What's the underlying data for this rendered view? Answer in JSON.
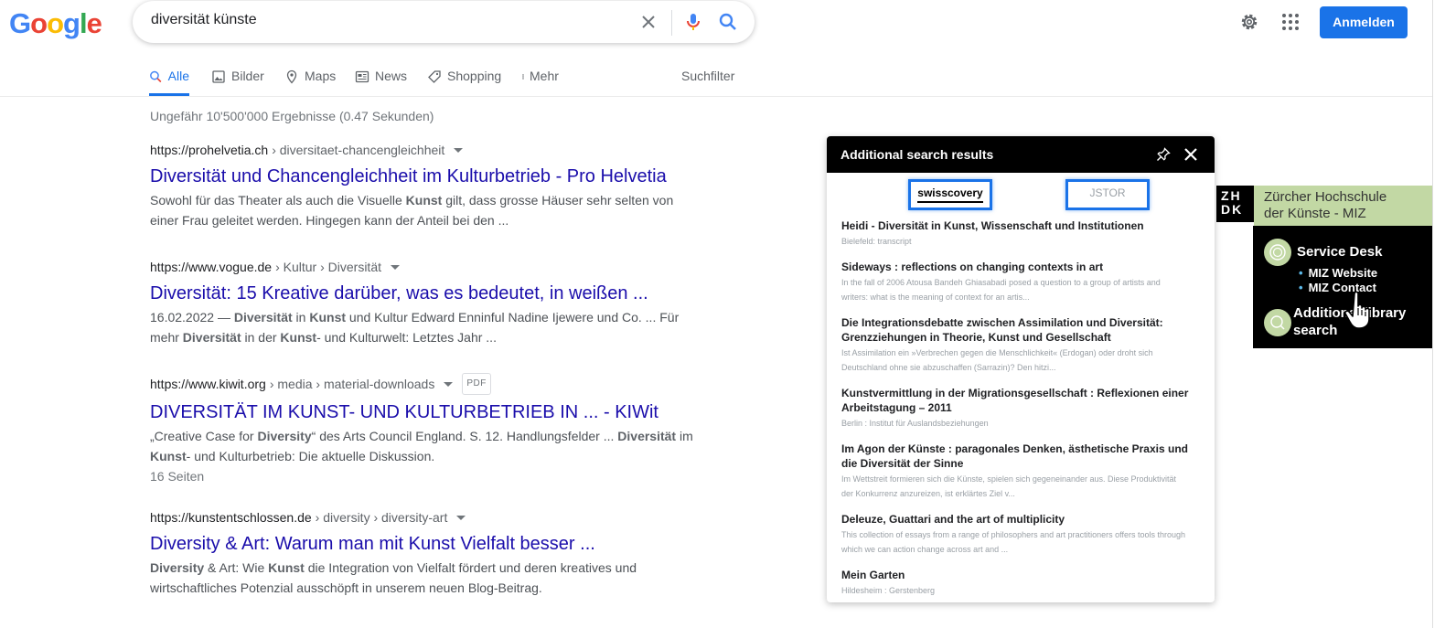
{
  "header": {
    "logo_letters": [
      "G",
      "o",
      "o",
      "g",
      "l",
      "e"
    ],
    "logo_colors": [
      "#4285F4",
      "#EA4335",
      "#FBBC05",
      "#4285F4",
      "#34A853",
      "#EA4335"
    ],
    "search_value": "diversität künste",
    "signin_label": "Anmelden"
  },
  "tabs": [
    {
      "label": "Alle",
      "icon": "search-icon",
      "active": true
    },
    {
      "label": "Bilder",
      "icon": "image-icon"
    },
    {
      "label": "Maps",
      "icon": "map-pin-icon"
    },
    {
      "label": "News",
      "icon": "news-icon"
    },
    {
      "label": "Shopping",
      "icon": "tag-icon"
    },
    {
      "label": "Mehr",
      "icon": "more-vert-icon"
    },
    {
      "label": "Suchfilter"
    }
  ],
  "stats": "Ungefähr 10'500'000 Ergebnisse (0.47 Sekunden)",
  "results": [
    {
      "domain": "https://prohelvetia.ch",
      "path": " › diversitaet-chancengleichheit",
      "title": "Diversität und Chancengleichheit im Kulturbetrieb - Pro Helvetia",
      "snippet_parts": [
        {
          "t": "Sowohl für das Theater als auch die Visuelle "
        },
        {
          "t": "Kunst",
          "b": true
        },
        {
          "t": " gilt, dass grosse Häuser sehr selten von einer Frau geleitet werden. Hingegen kann der Anteil bei den ..."
        }
      ]
    },
    {
      "domain": "https://www.vogue.de",
      "path": " › Kultur › Diversität",
      "title": "Diversität: 15 Kreative darüber, was es bedeutet, in weißen ...",
      "snippet_parts": [
        {
          "t": "16.02.2022 — "
        },
        {
          "t": "Diversität",
          "b": true
        },
        {
          "t": " in "
        },
        {
          "t": "Kunst",
          "b": true
        },
        {
          "t": " und Kultur Edward Enninful Nadine Ijewere und Co. ... Für mehr "
        },
        {
          "t": "Diversität",
          "b": true
        },
        {
          "t": " in der "
        },
        {
          "t": "Kunst",
          "b": true
        },
        {
          "t": "- und Kulturwelt: Letztes Jahr ..."
        }
      ]
    },
    {
      "domain": "https://www.kiwit.org",
      "path": " › media › material-downloads",
      "pdf": "PDF",
      "title": "DIVERSITÄT IM KUNST- UND KULTURBETRIEB IN ... - KIWit",
      "snippet_parts": [
        {
          "t": "„Creative Case for "
        },
        {
          "t": "Diversity",
          "b": true
        },
        {
          "t": "“ des Arts Council England. S. 12. Handlungsfelder ... "
        },
        {
          "t": "Diversität",
          "b": true
        },
        {
          "t": " im "
        },
        {
          "t": "Kunst",
          "b": true
        },
        {
          "t": "- und Kulturbetrieb: Die aktuelle Diskussion."
        }
      ],
      "extra": "16 Seiten"
    },
    {
      "domain": "https://kunstentschlossen.de",
      "path": " › diversity › diversity-art",
      "title": "Diversity & Art: Warum man mit Kunst Vielfalt besser ...",
      "snippet_parts": [
        {
          "t": "Diversity",
          "b": true
        },
        {
          "t": " & Art: Wie "
        },
        {
          "t": "Kunst",
          "b": true
        },
        {
          "t": " die Integration von Vielfalt fördert und deren kreatives und wirtschaftliches Potenzial ausschöpft in unserem neuen Blog-Beitrag."
        }
      ]
    }
  ],
  "panel": {
    "title": "Additional search results",
    "tab_swisscovery": "swisscovery",
    "tab_jstor": "JSTOR",
    "items": [
      {
        "title": "Heidi - Diversität in Kunst, Wissenschaft und Institutionen",
        "sub": "Bielefeld: transcript"
      },
      {
        "title": "Sideways : reflections on changing contexts in art",
        "sub": "In the fall of 2006 Atousa Bandeh Ghiasabadi posed a question to a group of artists and writers: what is the meaning of context for an artis..."
      },
      {
        "title": "Die Integrationsdebatte zwischen Assimilation und Diversität: Grenzziehungen in Theorie, Kunst und Gesellschaft",
        "sub": "Ist Assimilation ein »Verbrechen gegen die Menschlichkeit« (Erdogan) oder droht sich Deutschland ohne sie abzuschaffen (Sarrazin)? Den hitzi..."
      },
      {
        "title": "Kunstvermittlung in der Migrationsgesellschaft : Reflexionen einer Arbeitstagung – 2011",
        "sub": "Berlin : Institut für Auslandsbeziehungen"
      },
      {
        "title": "Im Agon der Künste : paragonales Denken, ästhetische Praxis und die Diversität der Sinne",
        "sub": "Im Wettstreit formieren sich die Künste, spielen sich gegeneinander aus. Diese Produktivität der Konkurrenz anzureizen, ist erklärtes Ziel v..."
      },
      {
        "title": "Deleuze, Guattari and the art of multiplicity",
        "sub": "This collection of essays from a range of philosophers and art practitioners offers tools through which we can action change across art and ..."
      },
      {
        "title": "Mein Garten",
        "sub": "Hildesheim : Gerstenberg"
      }
    ]
  },
  "zhdk": {
    "logo_line1": "ZH",
    "logo_line2": "DK",
    "name_line1": "Zürcher Hochschule",
    "name_line2": "der Künste - MIZ",
    "service_desk": "Service Desk",
    "links": [
      "MIZ Website",
      "MIZ Contact"
    ],
    "als_line1": "Additional library",
    "als_line2": "search"
  }
}
